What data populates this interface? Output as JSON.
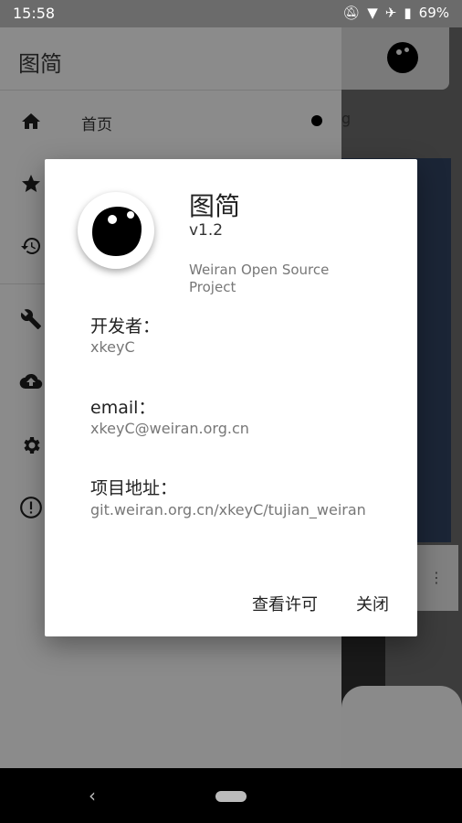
{
  "status_bar": {
    "time": "15:58",
    "battery": "69%"
  },
  "drawer": {
    "title": "图简",
    "items": [
      {
        "icon": "home-icon",
        "label": "首页"
      },
      {
        "icon": "star-icon",
        "label": ""
      },
      {
        "icon": "history-icon",
        "label": ""
      },
      {
        "icon": "wrench-icon",
        "label": ""
      },
      {
        "icon": "cloud-upload-icon",
        "label": ""
      },
      {
        "icon": "gear-icon",
        "label": ""
      },
      {
        "icon": "info-icon",
        "label": ""
      }
    ]
  },
  "background": {
    "partial_text": "g"
  },
  "dialog": {
    "app_name": "图简",
    "version": "v1.2",
    "org": "Weiran Open Source Project",
    "fields": [
      {
        "label": "开发者：",
        "value": "xkeyC"
      },
      {
        "label": "email：",
        "value": "xkeyC@weiran.org.cn"
      },
      {
        "label": "项目地址：",
        "value": "git.weiran.org.cn/xkeyC/tujian_weiran"
      }
    ],
    "buttons": {
      "license": "查看许可",
      "close": "关闭"
    }
  }
}
